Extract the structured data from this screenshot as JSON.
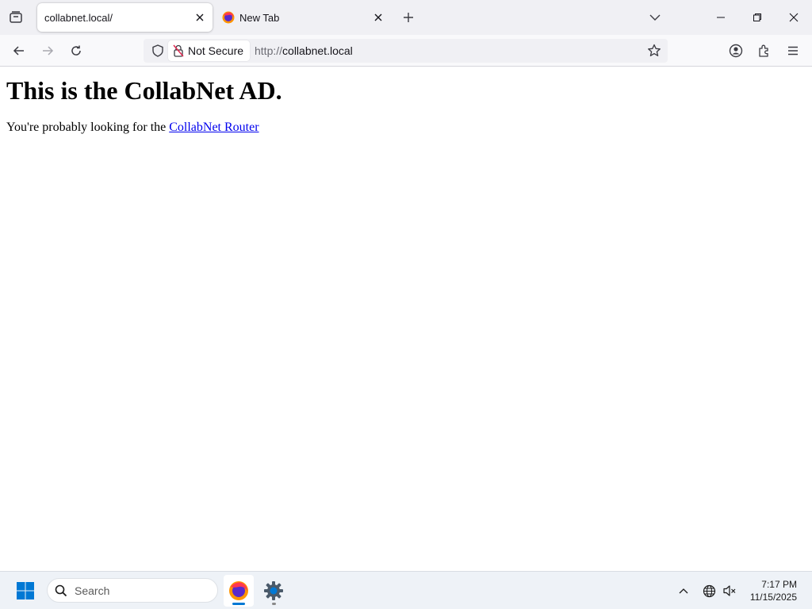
{
  "browser": {
    "tabs": [
      {
        "title": "collabnet.local/",
        "active": true
      },
      {
        "title": "New Tab",
        "active": false
      }
    ],
    "address_bar": {
      "security_label": "Not Secure",
      "url_protocol": "http://",
      "url_host": "collabnet.local"
    }
  },
  "page": {
    "heading": "This is the CollabNet AD.",
    "paragraph_prefix": "You're probably looking for the ",
    "link_text": "CollabNet Router"
  },
  "taskbar": {
    "search_label": "Search",
    "time": "7:17 PM",
    "date": "11/15/2025"
  },
  "colors": {
    "link": "#0000ee",
    "tabbar_bg": "#f0f0f4",
    "accent_blue": "#0078d4"
  }
}
